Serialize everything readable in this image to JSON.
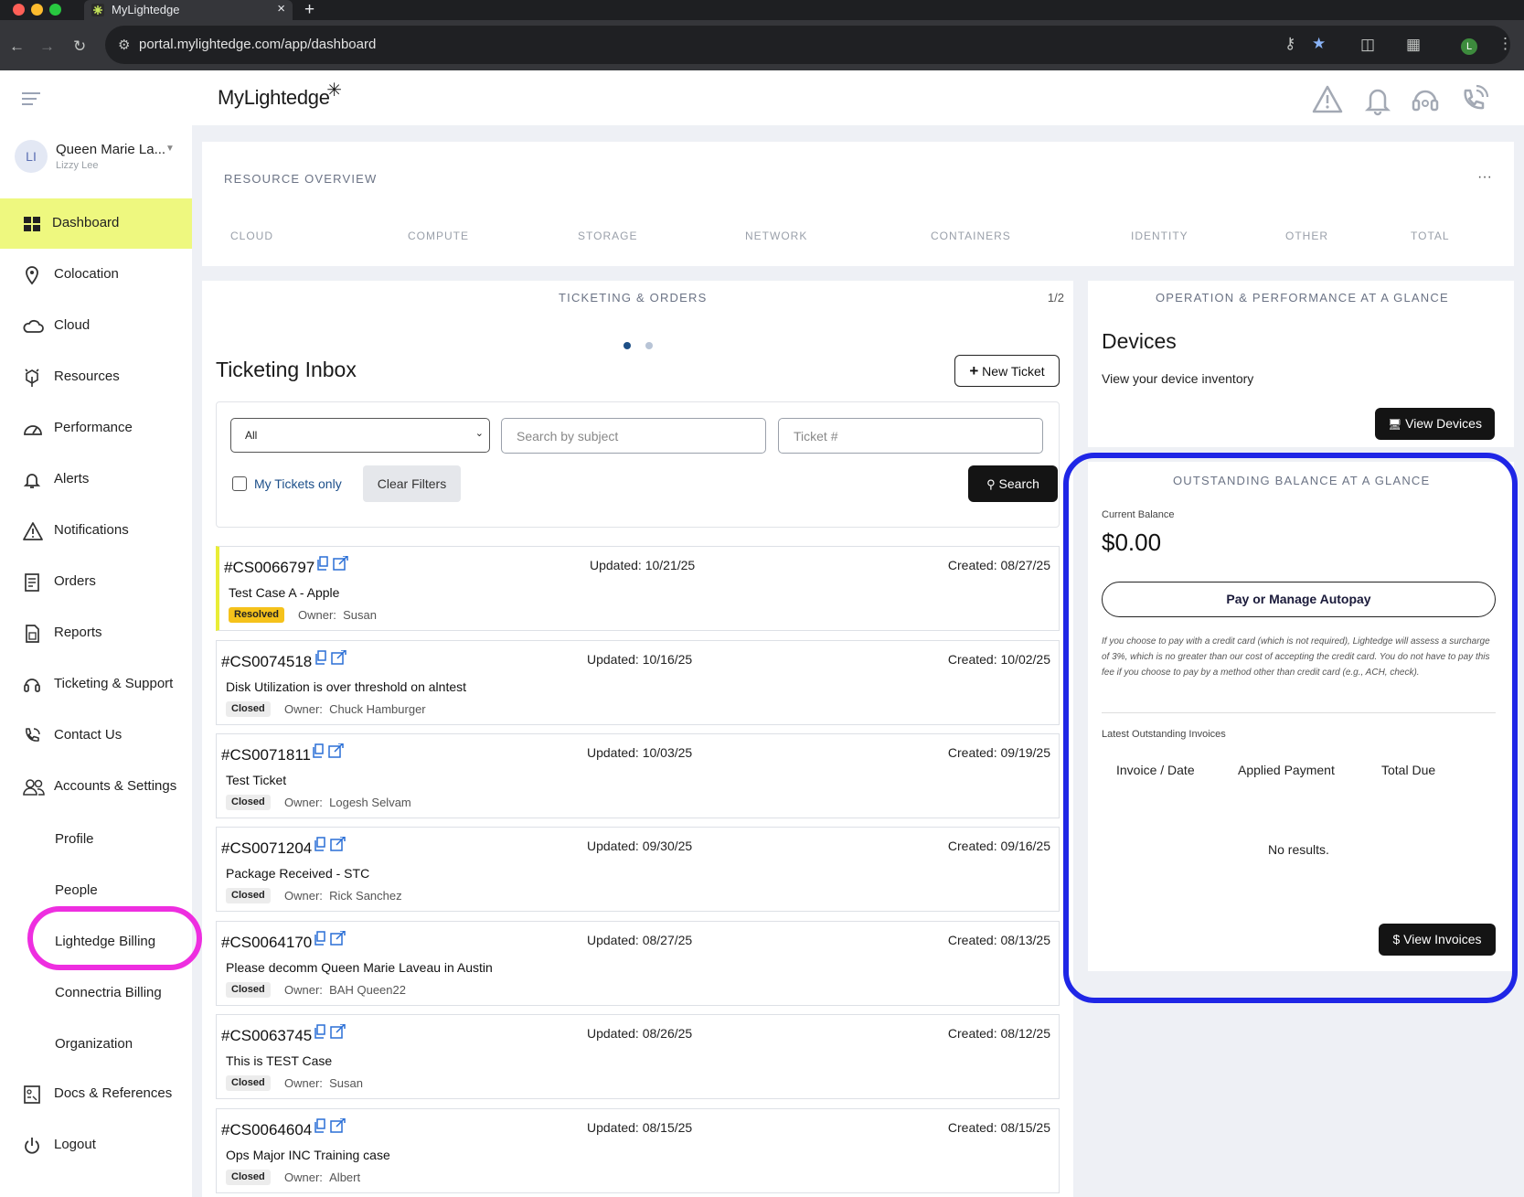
{
  "browser": {
    "tab_title": "MyLightedge",
    "tab_close": "×",
    "new_tab": "+",
    "url": "portal.mylightedge.com/app/dashboard",
    "profile_initial": "L"
  },
  "header": {
    "logo": "MyLightedge",
    "logo_mark": "✳",
    "icons": [
      "warning-icon",
      "bell-icon",
      "headset-icon",
      "phone-icon"
    ]
  },
  "user": {
    "initials": "LI",
    "name": "Queen Marie La...",
    "sub": "Lizzy Lee"
  },
  "sidebar": {
    "items": [
      {
        "label": "Dashboard",
        "icon": "dashboard-icon"
      },
      {
        "label": "Colocation",
        "icon": "location-pin-icon"
      },
      {
        "label": "Cloud",
        "icon": "cloud-icon"
      },
      {
        "label": "Resources",
        "icon": "resources-icon"
      },
      {
        "label": "Performance",
        "icon": "gauge-icon"
      },
      {
        "label": "Alerts",
        "icon": "bell-icon"
      },
      {
        "label": "Notifications",
        "icon": "warning-icon"
      },
      {
        "label": "Orders",
        "icon": "orders-icon"
      },
      {
        "label": "Reports",
        "icon": "reports-icon"
      },
      {
        "label": "Ticketing & Support",
        "icon": "headset-icon"
      },
      {
        "label": "Contact Us",
        "icon": "phone-icon"
      },
      {
        "label": "Accounts & Settings",
        "icon": "users-icon"
      }
    ],
    "subitems": [
      "Profile",
      "People",
      "Lightedge Billing",
      "Connectria Billing",
      "Organization"
    ],
    "bottom": [
      {
        "label": "Docs & References",
        "icon": "docs-icon"
      },
      {
        "label": "Logout",
        "icon": "power-icon"
      }
    ]
  },
  "resource_overview": {
    "title": "RESOURCE OVERVIEW",
    "more": "···",
    "columns": [
      "CLOUD",
      "COMPUTE",
      "STORAGE",
      "NETWORK",
      "CONTAINERS",
      "IDENTITY",
      "OTHER",
      "TOTAL"
    ]
  },
  "ticketing": {
    "section_title": "TICKETING & ORDERS",
    "pager": "1/2",
    "title": "Ticketing Inbox",
    "new_ticket": "New Ticket",
    "filter_selected": "All",
    "search_placeholder": "Search by subject",
    "ticket_placeholder": "Ticket #",
    "my_tickets": "My Tickets only",
    "clear_filters": "Clear Filters",
    "search_button": "Search",
    "owner_label": "Owner:",
    "tickets": [
      {
        "id": "#CS0066797",
        "updated": "Updated: 10/21/25",
        "created": "Created: 08/27/25",
        "subject": "Test Case A - Apple",
        "status": "Resolved",
        "owner": "Susan"
      },
      {
        "id": "#CS0074518",
        "updated": "Updated: 10/16/25",
        "created": "Created: 10/02/25",
        "subject": "Disk Utilization is over threshold on alntest",
        "status": "Closed",
        "owner": "Chuck Hamburger"
      },
      {
        "id": "#CS0071811",
        "updated": "Updated: 10/03/25",
        "created": "Created: 09/19/25",
        "subject": "Test Ticket",
        "status": "Closed",
        "owner": "Logesh Selvam"
      },
      {
        "id": "#CS0071204",
        "updated": "Updated: 09/30/25",
        "created": "Created: 09/16/25",
        "subject": "Package Received - STC",
        "status": "Closed",
        "owner": "Rick Sanchez"
      },
      {
        "id": "#CS0064170",
        "updated": "Updated: 08/27/25",
        "created": "Created: 08/13/25",
        "subject": "Please decomm Queen Marie Laveau in Austin",
        "status": "Closed",
        "owner": "BAH Queen22"
      },
      {
        "id": "#CS0063745",
        "updated": "Updated: 08/26/25",
        "created": "Created: 08/12/25",
        "subject": "This is TEST Case",
        "status": "Closed",
        "owner": "Susan"
      },
      {
        "id": "#CS0064604",
        "updated": "Updated: 08/15/25",
        "created": "Created: 08/15/25",
        "subject": "Ops Major INC Training case",
        "status": "Closed",
        "owner": "Albert"
      }
    ]
  },
  "operations": {
    "section_title": "OPERATION & PERFORMANCE AT A GLANCE",
    "title": "Devices",
    "description": "View your device inventory",
    "button": "View Devices"
  },
  "balance": {
    "section_title": "OUTSTANDING BALANCE AT A GLANCE",
    "current_label": "Current Balance",
    "amount": "$0.00",
    "pay_button": "Pay or Manage Autopay",
    "disclaimer": "If you choose to pay with a credit card (which is not required), Lightedge will assess a surcharge of 3%, which is no greater than our cost of accepting the credit card. You do not have to pay this fee if you choose to pay by a method other than credit card (e.g., ACH, check).",
    "invoices_label": "Latest Outstanding Invoices",
    "columns": [
      "Invoice / Date",
      "Applied Payment",
      "Total Due"
    ],
    "empty": "No results.",
    "view_button": "View Invoices",
    "dollar": "$"
  },
  "colors": {
    "active_nav": "#eef87f",
    "resolved_badge": "#f5c21b",
    "closed_badge": "#ececec",
    "annotation_blue": "#1f26e6",
    "annotation_pink": "#ee2ee0"
  }
}
